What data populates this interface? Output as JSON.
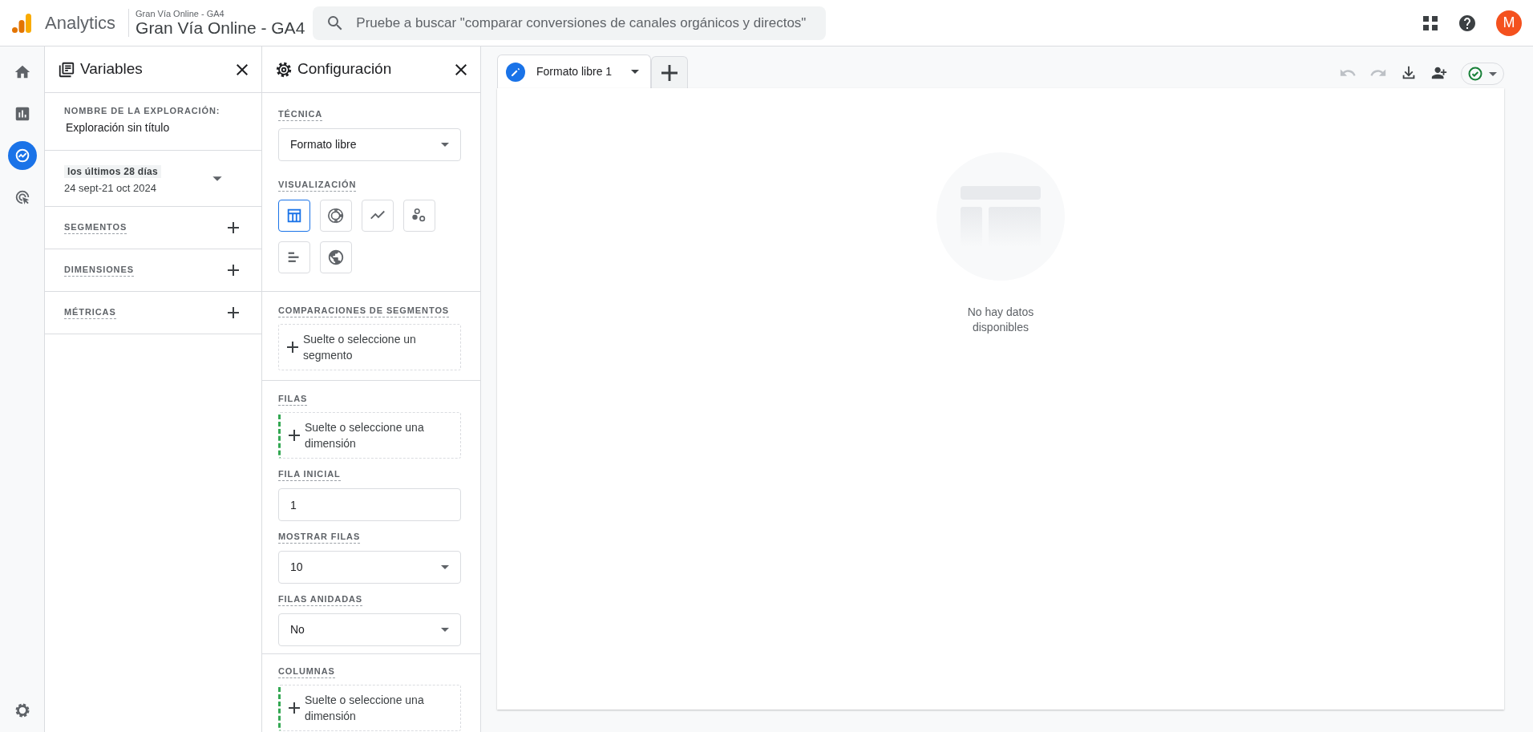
{
  "header": {
    "app_name": "Analytics",
    "property_subtitle": "Gran Vía Online - GA4",
    "property_name": "Gran Vía Online - GA4",
    "search": {
      "placeholder": "Pruebe a buscar \"comparar conversiones de canales orgánicos y directos\""
    },
    "avatar": "M"
  },
  "nav_rail": [
    {
      "kind": "home",
      "selected": false
    },
    {
      "kind": "reports",
      "selected": false
    },
    {
      "kind": "explore",
      "selected": true
    },
    {
      "kind": "advertising",
      "selected": false
    }
  ],
  "variables_panel": {
    "title": "Variables",
    "name_label": "NOMBRE DE LA EXPLORACIÓN:",
    "name_value": "Exploración sin título",
    "date_chip": "los últimos 28 días",
    "date_range": "24 sept-21 oct 2024",
    "sections": [
      "SEGMENTOS",
      "DIMENSIONES",
      "MÉTRICAS"
    ]
  },
  "settings_panel": {
    "title": "Configuración",
    "technique_label": "TÉCNICA",
    "technique": "Formato libre",
    "visualization_label": "VISUALIZACIÓN",
    "visualizations": [
      {
        "kind": "table",
        "selected": true
      },
      {
        "kind": "donut",
        "selected": false
      },
      {
        "kind": "line",
        "selected": false
      },
      {
        "kind": "scatter",
        "selected": false
      },
      {
        "kind": "bar",
        "selected": false
      },
      {
        "kind": "geo",
        "selected": false
      }
    ],
    "segment_comparisons": {
      "label": "COMPARACIONES DE SEGMENTOS",
      "drop_zone": "Suelte o seleccione un segmento",
      "highlighted": false
    },
    "rows": {
      "label": "FILAS",
      "drop_zone": "Suelte o seleccione una dimensión",
      "highlighted": true
    },
    "start_row": {
      "label": "FILA INICIAL",
      "value": "1"
    },
    "show_rows": {
      "label": "MOSTRAR FILAS",
      "value": "10"
    },
    "nested_rows": {
      "label": "FILAS ANIDADAS",
      "value": "No"
    },
    "columns": {
      "label": "COLUMNAS",
      "drop_zone": "Suelte o seleccione una dimensión",
      "highlighted": true
    }
  },
  "tabs": [
    {
      "label": "Formato libre 1",
      "selected": true
    }
  ],
  "toolbar": [
    {
      "kind": "undo",
      "disabled": true
    },
    {
      "kind": "redo",
      "disabled": true
    },
    {
      "kind": "download",
      "disabled": false
    },
    {
      "kind": "share",
      "disabled": false
    }
  ],
  "canvas": {
    "empty_message": "No hay datos disponibles"
  }
}
